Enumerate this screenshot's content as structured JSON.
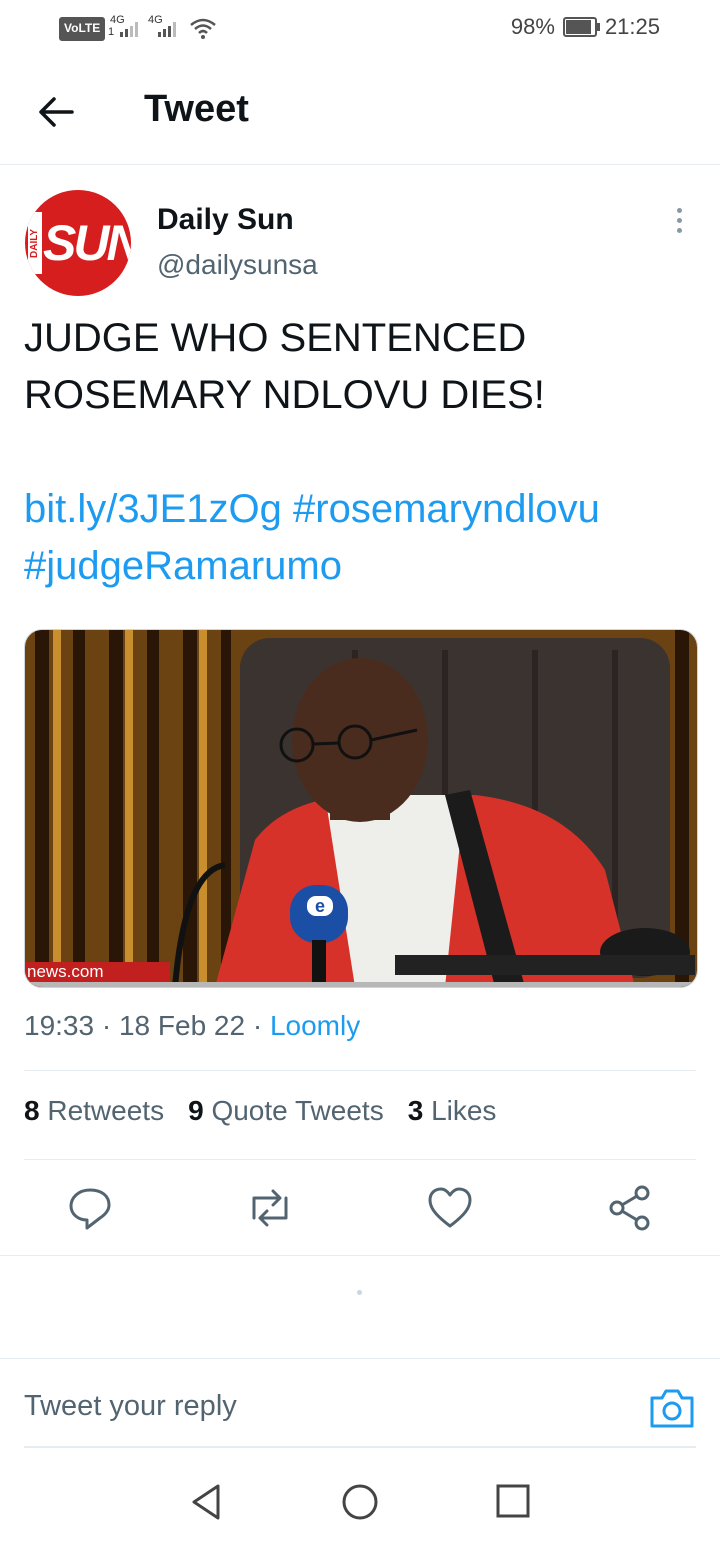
{
  "status_bar": {
    "volte": "VoLTE",
    "sim": "1",
    "network_1": "4G",
    "network_2": "4G",
    "battery_percent": "98%",
    "battery_level": 0.98,
    "time": "21:25"
  },
  "header": {
    "title": "Tweet",
    "back_icon": "arrow-left-icon"
  },
  "tweet": {
    "avatar_text_side": "DAILY",
    "avatar_text_main": "SUN",
    "author_name": "Daily Sun",
    "author_handle": "@dailysunsa",
    "text_line1": "JUDGE WHO SENTENCED",
    "text_line2": "ROSEMARY NDLOVU DIES!",
    "link": "bit.ly/3JE1zOg",
    "hashtag1": "#rosemaryndlovu",
    "hashtag2": "#judgeRamarumo",
    "media_watermark": "news.com",
    "mic_logo": "e",
    "time": "19:33",
    "date": "18 Feb 22",
    "source": "Loomly",
    "retweets_count": "8",
    "retweets_label": "Retweets",
    "quotes_count": "9",
    "quotes_label": "Quote Tweets",
    "likes_count": "3",
    "likes_label": "Likes"
  },
  "actions": [
    "reply-icon",
    "retweet-icon",
    "like-icon",
    "share-icon"
  ],
  "reply_bar": {
    "placeholder": "Tweet your reply",
    "camera_icon": "camera-icon"
  },
  "colors": {
    "link": "#1d9bf0",
    "brand_red": "#d71e1e",
    "muted": "#536471"
  }
}
